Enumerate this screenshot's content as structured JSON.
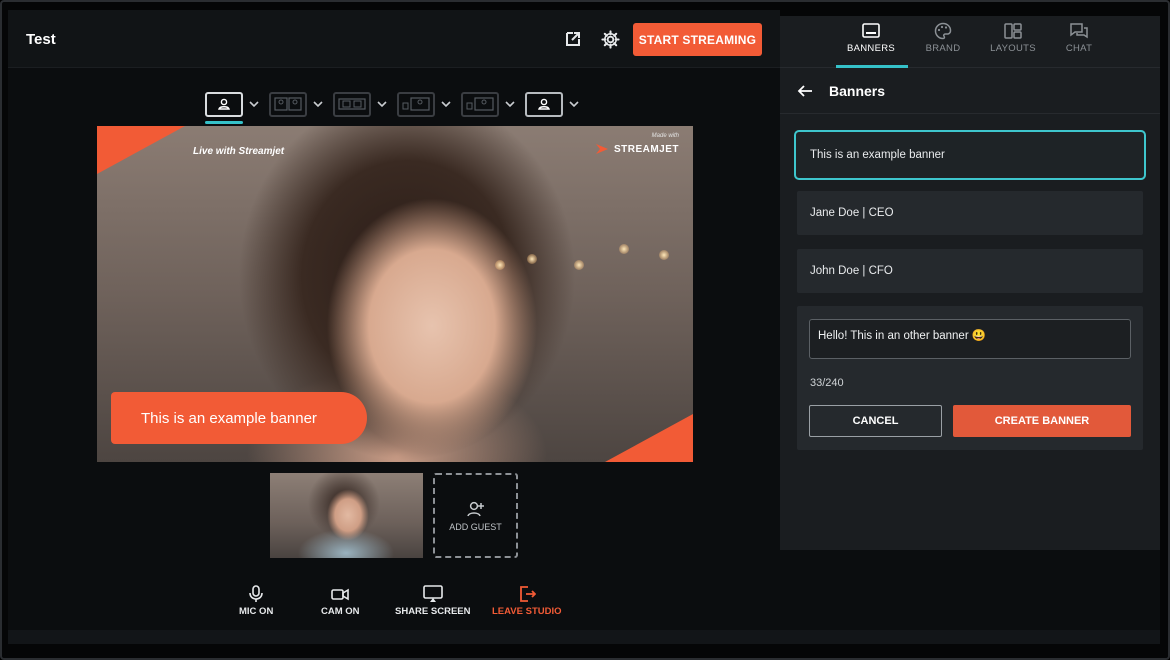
{
  "studio": {
    "title": "Test",
    "start_streaming_label": "START STREAMING",
    "stage": {
      "overlay_text": "Live with Streamjet",
      "brand_small_text": "Made with",
      "brand_name": "STREAMJET",
      "banner_text": "This is an example banner"
    },
    "add_guest_label": "ADD GUEST",
    "controls": [
      {
        "label": "MIC ON",
        "icon": "microphone-icon"
      },
      {
        "label": "CAM ON",
        "icon": "camera-icon"
      },
      {
        "label": "SHARE SCREEN",
        "icon": "screen-share-icon"
      },
      {
        "label": "LEAVE STUDIO",
        "icon": "leave-icon"
      }
    ]
  },
  "panel": {
    "tabs": [
      {
        "label": "BANNERS",
        "icon": "banner-icon",
        "active": true
      },
      {
        "label": "BRAND",
        "icon": "palette-icon",
        "active": false
      },
      {
        "label": "LAYOUTS",
        "icon": "layouts-icon",
        "active": false
      },
      {
        "label": "CHAT",
        "icon": "chat-icon",
        "active": false
      }
    ],
    "header_title": "Banners",
    "banners": [
      {
        "text": "This is an example banner",
        "selected": true
      },
      {
        "text": "Jane Doe | CEO",
        "selected": false
      },
      {
        "text": "John Doe | CFO",
        "selected": false
      }
    ],
    "editor": {
      "value": "Hello! This in an other banner 😃",
      "counter": "33/240",
      "cancel_label": "CANCEL",
      "create_label": "CREATE BANNER"
    }
  },
  "colors": {
    "accent": "#f25b36",
    "teal": "#35c1c9",
    "panel_bg": "#1a1d20",
    "studio_bg": "#0b0d0f"
  }
}
